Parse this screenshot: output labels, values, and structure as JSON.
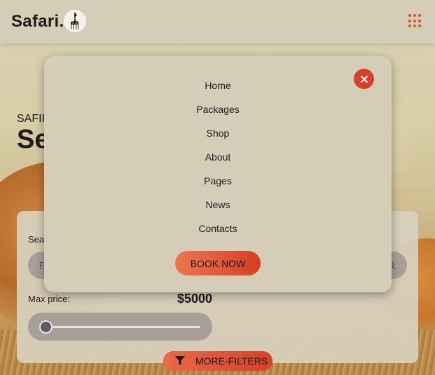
{
  "header": {
    "logo_text": "Safari.",
    "logo_icon": "giraffe-icon",
    "apps_icon": "grid-dots-icon"
  },
  "hero": {
    "subtitle": "SAFIR",
    "title": "Se"
  },
  "search": {
    "label": "Sea",
    "placeholder": "E",
    "icon": "search-icon"
  },
  "price": {
    "label": "Max price:",
    "value": "$5000",
    "slider_level": 0
  },
  "filters": {
    "label": "MORE-FILTERS",
    "icon": "filter-funnel-icon"
  },
  "menu": {
    "items": [
      "Home",
      "Packages",
      "Shop",
      "About",
      "Pages",
      "News",
      "Contacts"
    ],
    "book_label": "BOOK NOW",
    "close_icon": "close-icon"
  },
  "colors": {
    "accent": "#d8402a",
    "header_bg": "#d6cdb8",
    "panel_bg": "#d8d0bd",
    "input_bg": "#a99f99"
  }
}
